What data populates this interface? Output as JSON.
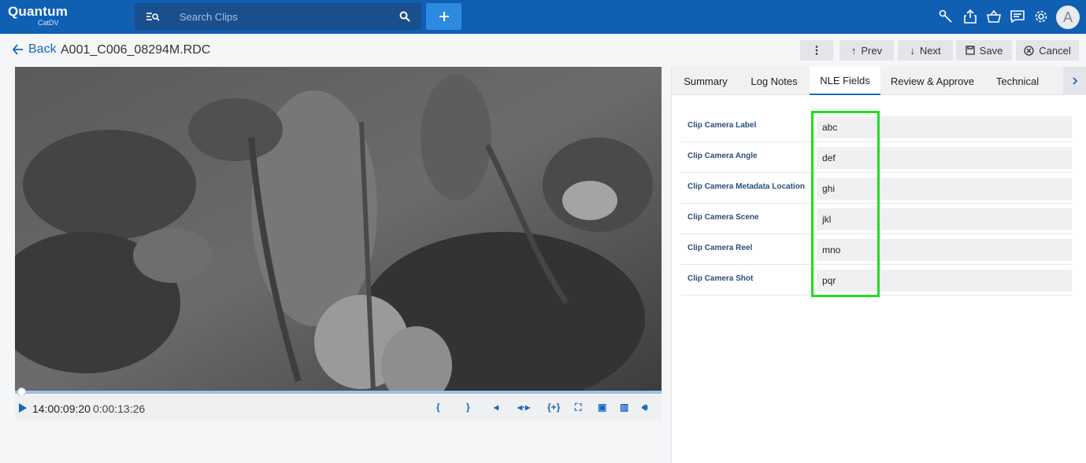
{
  "app": {
    "brand": "Quantum",
    "sub": "CatDV"
  },
  "search": {
    "placeholder": "Search Clips"
  },
  "header": {
    "back_label": "Back",
    "clip_title": "A001_C006_08294M.RDC",
    "prev_label": "Prev",
    "next_label": "Next",
    "save_label": "Save",
    "cancel_label": "Cancel"
  },
  "player": {
    "timecode": "14:00:09:20",
    "duration": "0:00:13:26",
    "progress": 0.005
  },
  "avatar_initial": "A",
  "tabs": [
    {
      "label": "Summary"
    },
    {
      "label": "Log Notes"
    },
    {
      "label": "NLE Fields"
    },
    {
      "label": "Review & Approve"
    },
    {
      "label": "Technical"
    }
  ],
  "active_tab": "NLE Fields",
  "fields": [
    {
      "label": "Clip Camera Label",
      "value": "abc"
    },
    {
      "label": "Clip Camera Angle",
      "value": "def"
    },
    {
      "label": "Clip Camera Metadata Location",
      "value": "ghi"
    },
    {
      "label": "Clip Camera Scene",
      "value": "jkl"
    },
    {
      "label": "Clip Camera Reel",
      "value": "mno"
    },
    {
      "label": "Clip Camera Shot",
      "value": "pqr"
    }
  ],
  "colors": {
    "topbar": "#0f5fb3",
    "accent": "#1967c1",
    "highlight": "#1de01d"
  }
}
